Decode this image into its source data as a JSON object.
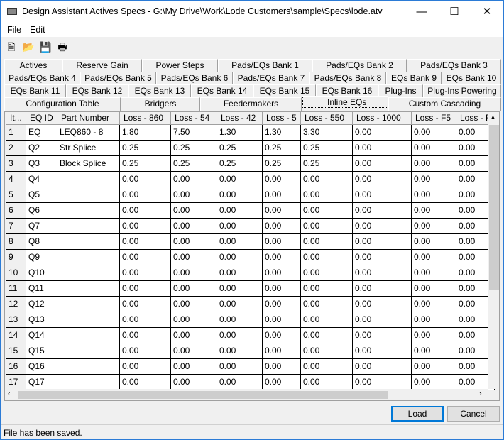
{
  "window": {
    "title": "Design Assistant Actives Specs - G:\\My Drive\\Work\\Lode Customers\\sample\\Specs\\lode.atv",
    "minimize": "—",
    "maximize": "☐",
    "close": "✕"
  },
  "menu": [
    "File",
    "Edit"
  ],
  "toolbar": [
    {
      "icon": "new-file-icon",
      "glyph": "🗎"
    },
    {
      "icon": "open-folder-icon",
      "glyph": "📂"
    },
    {
      "icon": "save-icon",
      "glyph": "💾"
    },
    {
      "icon": "print-icon",
      "glyph": "🖶"
    }
  ],
  "tabs": [
    [
      "Actives",
      "Reserve Gain",
      "Power Steps",
      "Pads/EQs Bank 1",
      "Pads/EQs Bank 2",
      "Pads/EQs Bank 3"
    ],
    [
      "Pads/EQs Bank 4",
      "Pads/EQs Bank 5",
      "Pads/EQs Bank 6",
      "Pads/EQs Bank 7",
      "Pads/EQs Bank 8",
      "EQs Bank 9",
      "EQs Bank 10"
    ],
    [
      "EQs Bank 11",
      "EQs Bank 12",
      "EQs Bank 13",
      "EQs Bank 14",
      "EQs Bank 15",
      "EQs Bank 16",
      "Plug-Ins",
      "Plug-Ins Powering"
    ],
    [
      "Configuration Table",
      "Bridgers",
      "Feedermakers",
      "Inline EQs",
      "Custom Cascading"
    ]
  ],
  "selected_tab": "Inline EQs",
  "grid": {
    "columns": [
      "It...",
      "EQ ID",
      "Part Number",
      "Loss - 860",
      "Loss - 54",
      "Loss - 42",
      "Loss - 5",
      "Loss - 550",
      "Loss - 1000",
      "Loss - F5",
      "Loss - F"
    ],
    "rows": [
      [
        "1",
        "EQ",
        "LEQ860 - 8",
        "1.80",
        "7.50",
        "1.30",
        "1.30",
        "3.30",
        "0.00",
        "0.00",
        "0.00"
      ],
      [
        "2",
        "Q2",
        "Str Splice",
        "0.25",
        "0.25",
        "0.25",
        "0.25",
        "0.25",
        "0.00",
        "0.00",
        "0.00"
      ],
      [
        "3",
        "Q3",
        "Block Splice",
        "0.25",
        "0.25",
        "0.25",
        "0.25",
        "0.25",
        "0.00",
        "0.00",
        "0.00"
      ],
      [
        "4",
        "Q4",
        "",
        "0.00",
        "0.00",
        "0.00",
        "0.00",
        "0.00",
        "0.00",
        "0.00",
        "0.00"
      ],
      [
        "5",
        "Q5",
        "",
        "0.00",
        "0.00",
        "0.00",
        "0.00",
        "0.00",
        "0.00",
        "0.00",
        "0.00"
      ],
      [
        "6",
        "Q6",
        "",
        "0.00",
        "0.00",
        "0.00",
        "0.00",
        "0.00",
        "0.00",
        "0.00",
        "0.00"
      ],
      [
        "7",
        "Q7",
        "",
        "0.00",
        "0.00",
        "0.00",
        "0.00",
        "0.00",
        "0.00",
        "0.00",
        "0.00"
      ],
      [
        "8",
        "Q8",
        "",
        "0.00",
        "0.00",
        "0.00",
        "0.00",
        "0.00",
        "0.00",
        "0.00",
        "0.00"
      ],
      [
        "9",
        "Q9",
        "",
        "0.00",
        "0.00",
        "0.00",
        "0.00",
        "0.00",
        "0.00",
        "0.00",
        "0.00"
      ],
      [
        "10",
        "Q10",
        "",
        "0.00",
        "0.00",
        "0.00",
        "0.00",
        "0.00",
        "0.00",
        "0.00",
        "0.00"
      ],
      [
        "11",
        "Q11",
        "",
        "0.00",
        "0.00",
        "0.00",
        "0.00",
        "0.00",
        "0.00",
        "0.00",
        "0.00"
      ],
      [
        "12",
        "Q12",
        "",
        "0.00",
        "0.00",
        "0.00",
        "0.00",
        "0.00",
        "0.00",
        "0.00",
        "0.00"
      ],
      [
        "13",
        "Q13",
        "",
        "0.00",
        "0.00",
        "0.00",
        "0.00",
        "0.00",
        "0.00",
        "0.00",
        "0.00"
      ],
      [
        "14",
        "Q14",
        "",
        "0.00",
        "0.00",
        "0.00",
        "0.00",
        "0.00",
        "0.00",
        "0.00",
        "0.00"
      ],
      [
        "15",
        "Q15",
        "",
        "0.00",
        "0.00",
        "0.00",
        "0.00",
        "0.00",
        "0.00",
        "0.00",
        "0.00"
      ],
      [
        "16",
        "Q16",
        "",
        "0.00",
        "0.00",
        "0.00",
        "0.00",
        "0.00",
        "0.00",
        "0.00",
        "0.00"
      ],
      [
        "17",
        "Q17",
        "",
        "0.00",
        "0.00",
        "0.00",
        "0.00",
        "0.00",
        "0.00",
        "0.00",
        "0.00"
      ]
    ]
  },
  "buttons": {
    "load": "Load",
    "cancel": "Cancel"
  },
  "status": "File has been saved."
}
